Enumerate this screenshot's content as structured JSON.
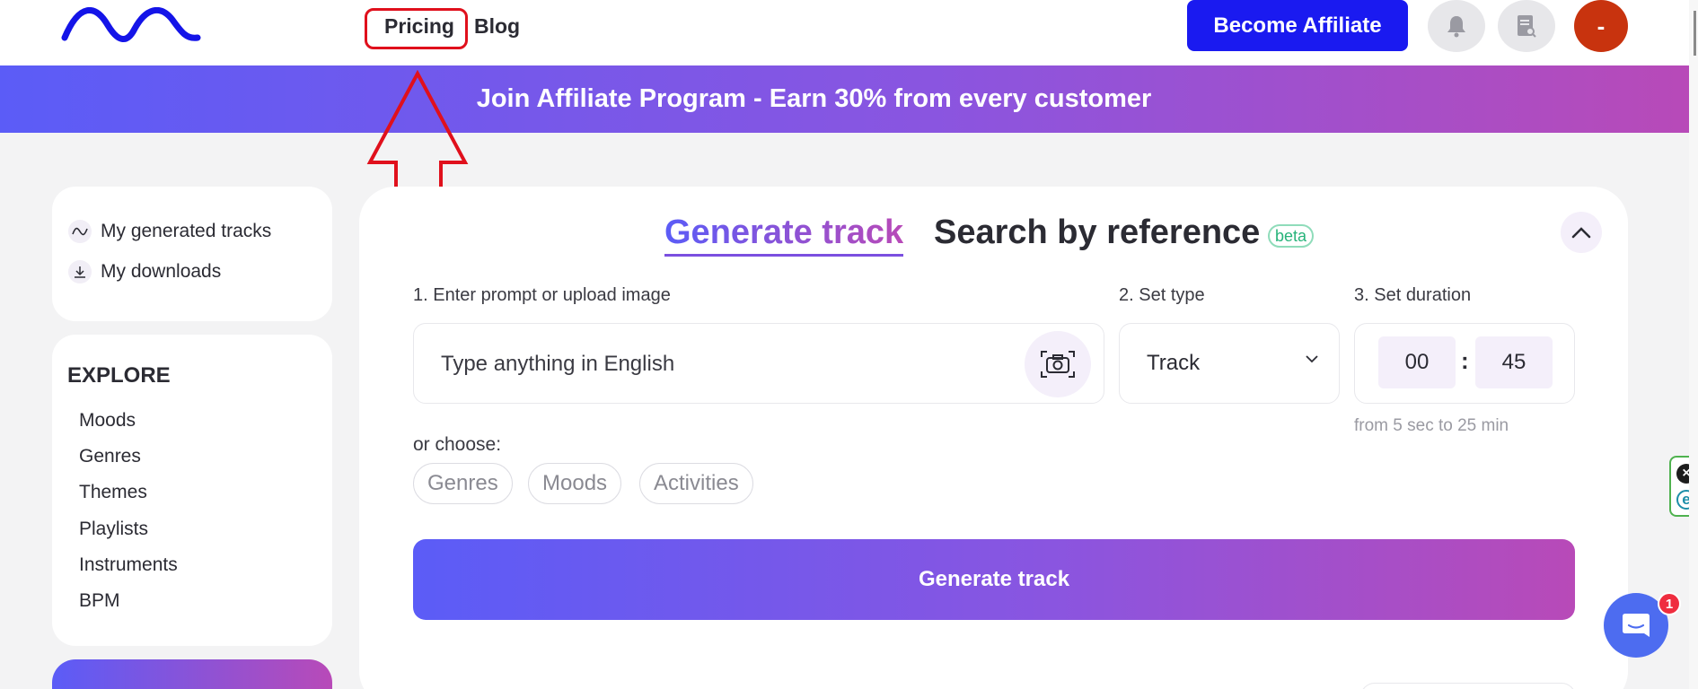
{
  "header": {
    "logo_icon": "wave-logo-icon",
    "nav": [
      {
        "label": "Pricing"
      },
      {
        "label": "Blog"
      }
    ],
    "affiliate_button": "Become Affiliate",
    "icons": [
      "bell-icon",
      "report-search-icon"
    ],
    "avatar_initial": "-"
  },
  "banner": {
    "text": "Join Affiliate Program - Earn 30% from every customer"
  },
  "sidebar": {
    "library": [
      {
        "label": "My generated tracks",
        "icon": "wave-icon"
      },
      {
        "label": "My downloads",
        "icon": "download-icon"
      }
    ],
    "explore_title": "EXPLORE",
    "explore_items": [
      "Moods",
      "Genres",
      "Themes",
      "Playlists",
      "Instruments",
      "BPM"
    ]
  },
  "main": {
    "tabs": [
      {
        "label": "Generate track",
        "active": true
      },
      {
        "label": "Search by reference",
        "active": false
      }
    ],
    "beta_badge": "beta",
    "steps": {
      "prompt_label": "1. Enter prompt or upload image",
      "type_label": "2. Set type",
      "duration_label": "3. Set duration"
    },
    "prompt_placeholder": "Type anything in English",
    "type_value": "Track",
    "duration": {
      "minutes": "00",
      "separator": ":",
      "seconds": "45",
      "hint": "from 5 sec to 25 min"
    },
    "choose_label": "or choose:",
    "chips": [
      "Genres",
      "Moods",
      "Activities"
    ],
    "generate_button": "Generate track"
  },
  "widgets": {
    "chat_unread_count": "1",
    "extension_letter": "e"
  },
  "colors": {
    "brand_blue": "#1a1af0",
    "gradient_start": "#5b5cf7",
    "gradient_end": "#b84ab8",
    "avatar": "#c8330e",
    "annotation_red": "#e0101c",
    "beta_green": "#27b37a"
  }
}
